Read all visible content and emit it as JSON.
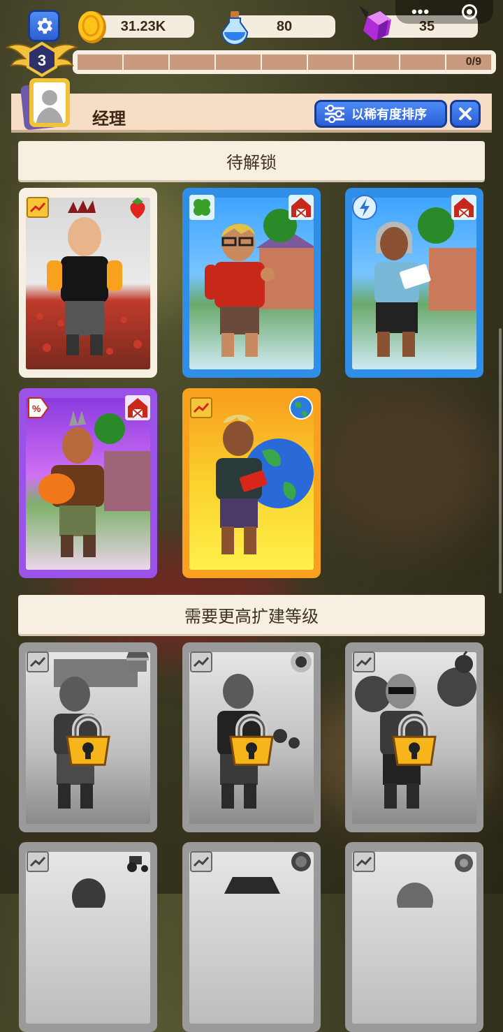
{
  "topbar": {
    "coins": "31.23K",
    "potions": "80",
    "gems": "35"
  },
  "level": {
    "number": "3",
    "progress_text": "0/9",
    "progress": 0
  },
  "header": {
    "title": "经理",
    "sort_label": "以稀有度排序"
  },
  "sections": {
    "locked": "待解锁",
    "need_higher": "需要更高扩建等级"
  },
  "cards_available": [
    {
      "frame": "cream",
      "left_icon": "chart-icon",
      "right_icon": "strawberry-icon",
      "scene": "strawberry-field"
    },
    {
      "frame": "blue",
      "left_icon": "clover-icon",
      "right_icon": "barn-icon",
      "scene": "house"
    },
    {
      "frame": "blue",
      "left_icon": "lightning-icon",
      "right_icon": "barn-icon",
      "scene": "house"
    },
    {
      "frame": "purple",
      "left_icon": "percent-tag-icon",
      "right_icon": "barn-icon",
      "scene": "house-pink"
    },
    {
      "frame": "orange",
      "left_icon": "chart-icon",
      "right_icon": "globe-icon",
      "scene": "globe"
    }
  ],
  "cards_locked": [
    {
      "left_icon": "chart-icon",
      "right_icon": "shop-icon"
    },
    {
      "left_icon": "chart-icon",
      "right_icon": "sunflower-icon"
    },
    {
      "left_icon": "chart-icon",
      "right_icon": "apple-icon"
    },
    {
      "left_icon": "chart-icon",
      "right_icon": "tractor-icon"
    },
    {
      "left_icon": "chart-icon",
      "right_icon": "cabbage-icon"
    },
    {
      "left_icon": "chart-icon",
      "right_icon": "fruit-icon"
    }
  ],
  "colors": {
    "accent_blue": "#2f8fe8",
    "rare_purple": "#9a52e8",
    "epic_orange": "#f7a11e",
    "lock_gold": "#f5b51b"
  }
}
